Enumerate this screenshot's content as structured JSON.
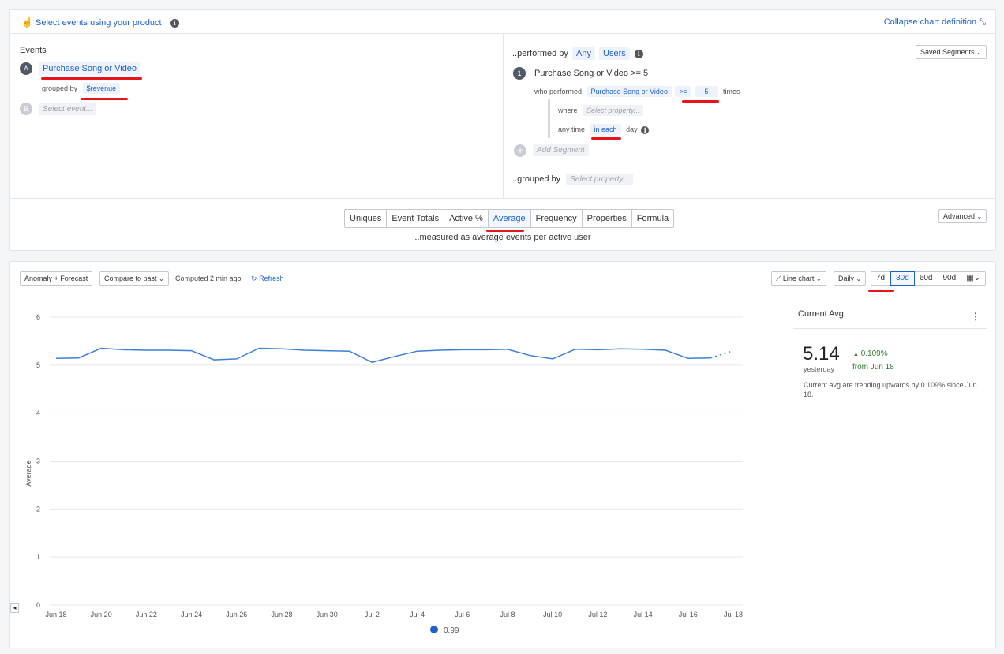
{
  "header": {
    "select_events_label": "Select events using your product",
    "collapse_label": "Collapse chart definition"
  },
  "events": {
    "title": "Events",
    "a_badge": "A",
    "a_event": "Purchase Song or Video",
    "grouped_by_label": "grouped by",
    "grouped_by_value": "$revenue",
    "b_badge": "B",
    "b_placeholder": "Select event..."
  },
  "segment": {
    "performed_by_label": "..performed by",
    "any": "Any",
    "users": "Users",
    "saved_segments": "Saved Segments",
    "number": "1",
    "title": "Purchase Song or Video >= 5",
    "who_performed_label": "who performed",
    "event": "Purchase Song or Video",
    "operator": ">=",
    "count": "5",
    "times_label": "times",
    "where_label": "where",
    "where_placeholder": "Select property...",
    "anytime_label": "any time",
    "in_each": "in each",
    "day_label": "day",
    "add_segment": "Add Segment",
    "grouped_by_label": "..grouped by",
    "grouped_by_placeholder": "Select property..."
  },
  "measure": {
    "tabs": [
      "Uniques",
      "Event Totals",
      "Active %",
      "Average",
      "Frequency",
      "Properties",
      "Formula"
    ],
    "active_tab": "Average",
    "description": "..measured as average events per active user",
    "advanced": "Advanced"
  },
  "toolbar": {
    "anomaly": "Anomaly + Forecast",
    "compare": "Compare to past",
    "computed": "Computed 2 min ago",
    "refresh": "Refresh",
    "chart_type": "Line chart",
    "interval": "Daily",
    "ranges": [
      "7d",
      "30d",
      "60d",
      "90d"
    ],
    "active_range": "30d"
  },
  "side": {
    "title": "Current Avg",
    "value": "5.14",
    "value_sub": "yesterday",
    "change": "0.109%",
    "change_from": "from Jun 18",
    "note": "Current avg are trending upwards by 0.109% since Jun 18."
  },
  "colors": {
    "accent": "#1e61ce",
    "line": "#3a7fd9",
    "positive": "#2e7d32",
    "annotation": "#e8141b"
  },
  "chart_data": {
    "type": "line",
    "ylabel": "Average",
    "ylim": [
      0,
      6
    ],
    "yticks": [
      0,
      1,
      2,
      3,
      4,
      5,
      6
    ],
    "x": [
      "Jun 18",
      "Jun 19",
      "Jun 20",
      "Jun 21",
      "Jun 22",
      "Jun 23",
      "Jun 24",
      "Jun 25",
      "Jun 26",
      "Jun 27",
      "Jun 28",
      "Jun 29",
      "Jun 30",
      "Jul 1",
      "Jul 2",
      "Jul 3",
      "Jul 4",
      "Jul 5",
      "Jul 6",
      "Jul 7",
      "Jul 8",
      "Jul 9",
      "Jul 10",
      "Jul 11",
      "Jul 12",
      "Jul 13",
      "Jul 14",
      "Jul 15",
      "Jul 16",
      "Jul 17",
      "Jul 18"
    ],
    "xtick_labels": [
      "Jun 18",
      "Jun 20",
      "Jun 22",
      "Jun 24",
      "Jun 26",
      "Jun 28",
      "Jun 30",
      "Jul 2",
      "Jul 4",
      "Jul 6",
      "Jul 8",
      "Jul 10",
      "Jul 12",
      "Jul 14",
      "Jul 16",
      "Jul 18"
    ],
    "series": [
      {
        "name": "0.99",
        "values": [
          5.14,
          5.15,
          5.35,
          5.32,
          5.31,
          5.31,
          5.3,
          5.11,
          5.13,
          5.35,
          5.34,
          5.31,
          5.3,
          5.29,
          5.06,
          5.18,
          5.29,
          5.31,
          5.32,
          5.32,
          5.33,
          5.2,
          5.13,
          5.33,
          5.32,
          5.34,
          5.33,
          5.31,
          5.14,
          5.15,
          5.3
        ],
        "forecast_from_index": 29
      }
    ],
    "grid": true,
    "legend": "bottom-center"
  }
}
